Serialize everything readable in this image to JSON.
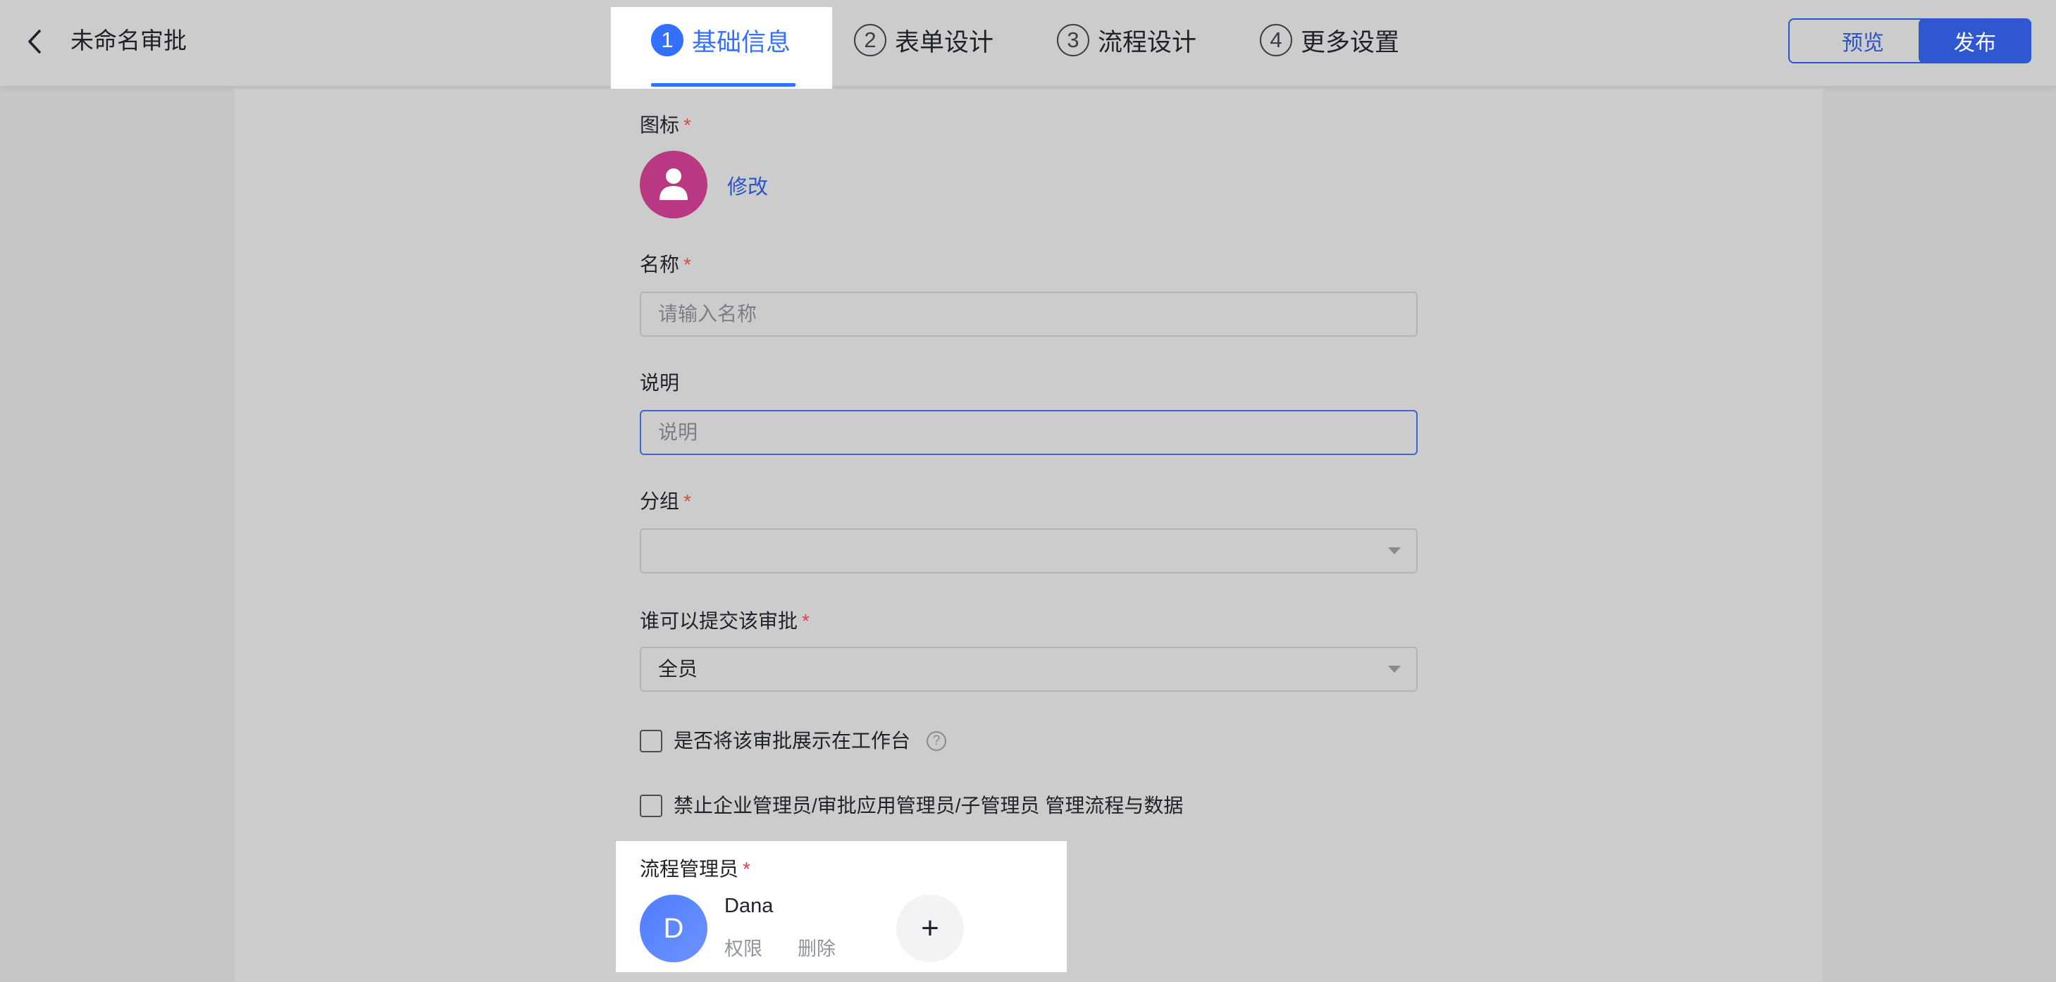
{
  "header": {
    "title": "未命名审批",
    "tabs": [
      {
        "num": "1",
        "label": "基础信息",
        "active": true
      },
      {
        "num": "2",
        "label": "表单设计",
        "active": false
      },
      {
        "num": "3",
        "label": "流程设计",
        "active": false
      },
      {
        "num": "4",
        "label": "更多设置",
        "active": false
      }
    ],
    "preview_label": "预览",
    "publish_label": "发布"
  },
  "form": {
    "icon": {
      "label": "图标",
      "required": "*",
      "modify_label": "修改",
      "icon_name": "user-icon"
    },
    "name": {
      "label": "名称",
      "required": "*",
      "placeholder": "请输入名称",
      "value": ""
    },
    "description": {
      "label": "说明",
      "placeholder": "说明",
      "value": ""
    },
    "group": {
      "label": "分组",
      "required": "*",
      "value": ""
    },
    "submitters": {
      "label": "谁可以提交该审批",
      "required": "*",
      "value": "全员"
    },
    "show_in_workbench": {
      "label": "是否将该审批展示在工作台",
      "checked": false,
      "help_icon": "?"
    },
    "forbid_admins": {
      "label": "禁止企业管理员/审批应用管理员/子管理员 管理流程与数据",
      "checked": false
    },
    "process_managers": {
      "label": "流程管理员",
      "required": "*",
      "managers": [
        {
          "initial": "D",
          "name": "Dana",
          "permission_label": "权限",
          "delete_label": "删除"
        }
      ],
      "add_label": "+"
    }
  },
  "colors": {
    "accent": "#3370ff",
    "primary_button": "#2f58d0",
    "required": "#e54545",
    "icon_avatar": "#b93882",
    "manager_avatar": "#4f7dff"
  }
}
